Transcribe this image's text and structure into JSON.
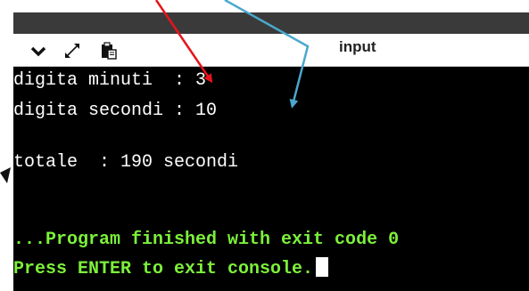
{
  "toolbar": {
    "label": "input",
    "icons": [
      "chevron-down-icon",
      "expand-icon",
      "paste-icon"
    ]
  },
  "console": {
    "line1": "digita minuti  : 3",
    "line2": "digita secondi : 10",
    "line3": "totale  : 190 secondi",
    "line4": "...Program finished with exit code 0",
    "line5": "Press ENTER to exit console."
  },
  "colors": {
    "console_bg": "#000000",
    "console_text": "#ffffff",
    "success_text": "#7cf03a",
    "annotation_red": "#e8141b",
    "annotation_blue": "#4aa8cc"
  }
}
